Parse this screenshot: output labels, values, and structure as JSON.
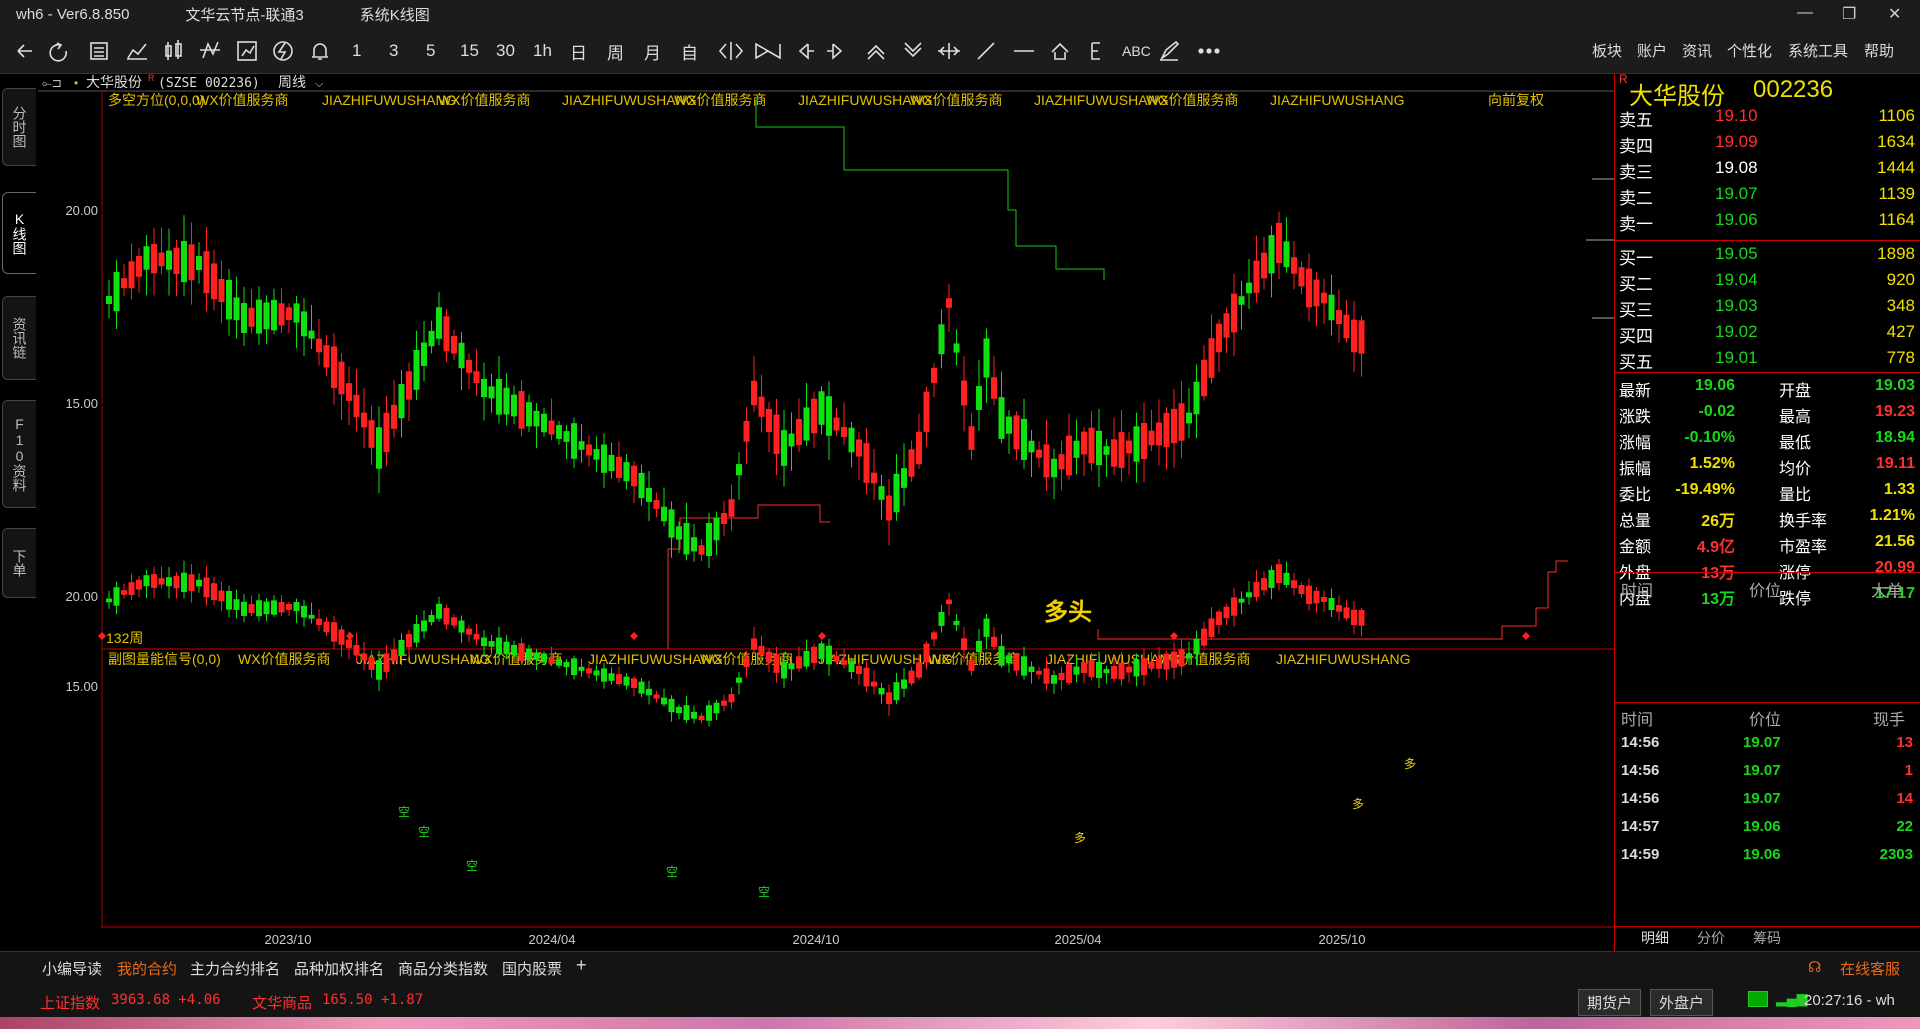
{
  "title": {
    "app": "wh6  -  Ver6.8.850",
    "server": "文华云节点-联通3",
    "mode": "系统K线图"
  },
  "window_controls": [
    "—",
    "❐",
    "✕"
  ],
  "toolbar_icons": [
    "back-arrow-icon",
    "refresh-icon",
    "table-icon",
    "line-chart-icon",
    "candlestick-icon",
    "wave-icon",
    "save-chart-icon",
    "lightning-icon",
    "bell-icon"
  ],
  "periods": [
    "1",
    "3",
    "5",
    "15",
    "30",
    "1h",
    "日",
    "周",
    "月",
    "自"
  ],
  "toolbar_extra": [
    "ABC"
  ],
  "menu": [
    "板块",
    "账户",
    "资讯",
    "个性化",
    "系统工具",
    "帮助"
  ],
  "left_tabs": [
    "分时图",
    "K线图",
    "资讯链",
    "F10资料",
    "下单"
  ],
  "header": {
    "name": "大华股份",
    "mark": "R",
    "code": "(SZSE 002236)",
    "period": "周线"
  },
  "main_indicator": {
    "name": "多空方位(0,0,0)",
    "label": "向前复权",
    "count": "132周",
    "signal": "多头"
  },
  "sub_indicator": {
    "name": "副图量能信号(0,0)"
  },
  "watermark": [
    "WX价值服务商",
    "JIAZHIFUWUSHANG",
    "WX价值服务商",
    "JIAZHIFUWUSHANG",
    "WX价值服务商",
    "JIAZHIFUWUSHANG",
    "WX价值服务商",
    "JIAZHIFUWUSHANG",
    "WX价值服务商",
    "JIAZHIFUWUSHANG"
  ],
  "y_labels_main": [
    "20.00",
    "15.00"
  ],
  "y_labels_sub": [
    "20.00",
    "15.00"
  ],
  "x_labels": [
    "2023/10",
    "2024/04",
    "2024/10",
    "2025/04",
    "2025/10"
  ],
  "sub_markers": [
    "空",
    "空",
    "空",
    "空",
    "空",
    "多",
    "多",
    "多"
  ],
  "chart_data": {
    "type": "candlestick",
    "period": "weekly",
    "price_levels": [
      20.0,
      15.0
    ]
  },
  "quote": {
    "name": "大华股份",
    "code": "002236",
    "asks": [
      {
        "l": "卖五",
        "p": "19.10",
        "v": "1106",
        "c": "red"
      },
      {
        "l": "卖四",
        "p": "19.09",
        "v": "1634",
        "c": "red"
      },
      {
        "l": "卖三",
        "p": "19.08",
        "v": "1444",
        "c": "white"
      },
      {
        "l": "卖二",
        "p": "19.07",
        "v": "1139",
        "c": "green"
      },
      {
        "l": "卖一",
        "p": "19.06",
        "v": "1164",
        "c": "green"
      }
    ],
    "bids": [
      {
        "l": "买一",
        "p": "19.05",
        "v": "1898",
        "c": "green"
      },
      {
        "l": "买二",
        "p": "19.04",
        "v": "920",
        "c": "green"
      },
      {
        "l": "买三",
        "p": "19.03",
        "v": "348",
        "c": "green"
      },
      {
        "l": "买四",
        "p": "19.02",
        "v": "427",
        "c": "green"
      },
      {
        "l": "买五",
        "p": "19.01",
        "v": "778",
        "c": "green"
      }
    ],
    "stats": [
      {
        "a": "最新",
        "av": "19.06",
        "ac": "green",
        "b": "开盘",
        "bv": "19.03",
        "bc": "green"
      },
      {
        "a": "涨跌",
        "av": "-0.02",
        "ac": "green",
        "b": "最高",
        "bv": "19.23",
        "bc": "red"
      },
      {
        "a": "涨幅",
        "av": "-0.10%",
        "ac": "green",
        "b": "最低",
        "bv": "18.94",
        "bc": "green"
      },
      {
        "a": "振幅",
        "av": "1.52%",
        "ac": "yellow",
        "b": "均价",
        "bv": "19.11",
        "bc": "red"
      },
      {
        "a": "委比",
        "av": "-19.49%",
        "ac": "yellow",
        "b": "量比",
        "bv": "1.33",
        "bc": "yellow"
      },
      {
        "a": "总量",
        "av": "26万",
        "ac": "yellow",
        "b": "换手率",
        "bv": "1.21%",
        "bc": "yellow"
      },
      {
        "a": "金额",
        "av": "4.9亿",
        "ac": "red",
        "b": "市盈率",
        "bv": "21.56",
        "bc": "yellow"
      },
      {
        "a": "外盘",
        "av": "13万",
        "ac": "red",
        "b": "涨停",
        "bv": "20.99",
        "bc": "red"
      },
      {
        "a": "内盘",
        "av": "13万",
        "ac": "green",
        "b": "跌停",
        "bv": "17.17",
        "bc": "green"
      }
    ]
  },
  "big_orders": {
    "h1": "时间",
    "h2": "价位",
    "h3": "大单"
  },
  "ticks": {
    "h1": "时间",
    "h2": "价位",
    "h3": "现手",
    "rows": [
      {
        "t": "14:56",
        "p": "19.07",
        "v": "13",
        "vc": "red"
      },
      {
        "t": "14:56",
        "p": "19.07",
        "v": "1",
        "vc": "red"
      },
      {
        "t": "14:56",
        "p": "19.07",
        "v": "14",
        "vc": "red"
      },
      {
        "t": "14:57",
        "p": "19.06",
        "v": "22",
        "vc": "green"
      },
      {
        "t": "14:59",
        "p": "19.06",
        "v": "2303",
        "vc": "green"
      }
    ]
  },
  "rp_tabs": [
    "明细",
    "分价",
    "筹码"
  ],
  "bottom_tabs": [
    "小编导读",
    "我的合约",
    "主力合约排名",
    "品种加权排名",
    "商品分类指数",
    "国内股票",
    "+"
  ],
  "service": "在线客服",
  "status": {
    "i1": "上证指数",
    "v1": "3963.68 +4.06",
    "i2": "文华商品",
    "v2": "165.50 +1.87",
    "b1": "期货户",
    "b2": "外盘户",
    "time": "20:27:16 - wh"
  },
  "colors": {
    "up": "#ff2020",
    "down": "#10e010",
    "accent": "#e05010",
    "border": "#c00000"
  }
}
